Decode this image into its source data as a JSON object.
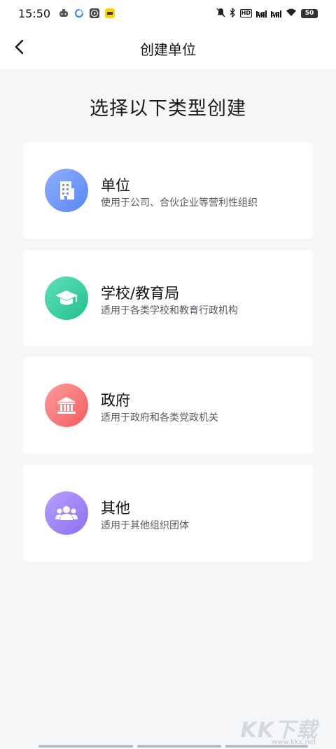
{
  "status_bar": {
    "time": "15:50",
    "hd_label": "HD",
    "network_4g": "4G",
    "network_5g": "5G",
    "battery": "50"
  },
  "nav": {
    "title": "创建单位"
  },
  "heading": "选择以下类型创建",
  "cards": [
    {
      "title": "单位",
      "desc": "使用于公司、合伙企业等营利性组织",
      "icon": "building-icon",
      "color_from": "#8fb0ff",
      "color_to": "#5a86f5"
    },
    {
      "title": "学校/教育局",
      "desc": "适用于各类学校和教育行政机构",
      "icon": "graduation-cap-icon",
      "color_from": "#5fe1b8",
      "color_to": "#22c08e"
    },
    {
      "title": "政府",
      "desc": "适用于政府和各类党政机关",
      "icon": "government-building-icon",
      "color_from": "#ff9a9a",
      "color_to": "#f25e60"
    },
    {
      "title": "其他",
      "desc": "适用于其他组织团体",
      "icon": "group-icon",
      "color_from": "#b7a0ff",
      "color_to": "#8d6ef2"
    }
  ],
  "watermark": {
    "text": "KK下载",
    "url": "www.kkx.net"
  }
}
